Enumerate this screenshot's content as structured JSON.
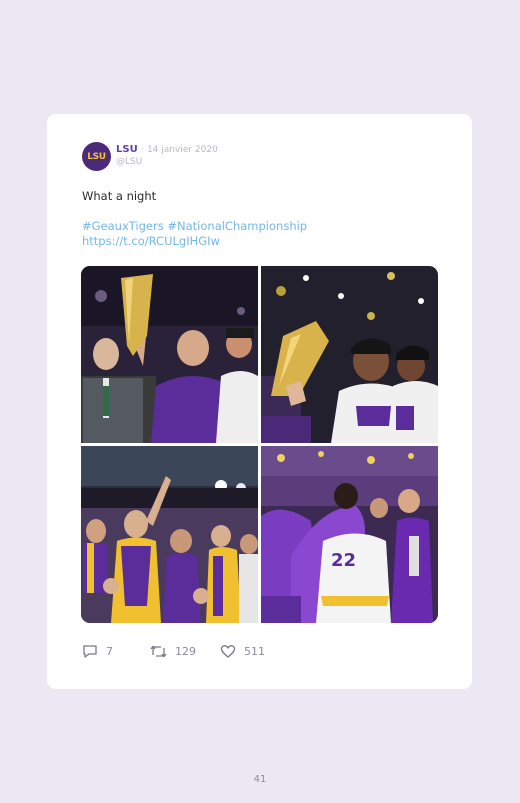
{
  "tweet": {
    "account_name": "LSU",
    "separator": "·",
    "date": "14 janvier 2020",
    "handle": "@LSU",
    "avatar_text": "LSU",
    "text": "What a night",
    "hashtags": "#GeauxTigers #NationalChampionship",
    "link": "https://t.co/RCULgIHGIw",
    "photos": [
      {
        "subject": "coach-lifting-trophy"
      },
      {
        "subject": "players-with-trophy"
      },
      {
        "subject": "fans-in-stands"
      },
      {
        "subject": "players-celebrating"
      }
    ],
    "replies": "7",
    "retweets": "129",
    "likes": "511"
  },
  "page": {
    "number": "41"
  },
  "colors": {
    "background": "#ebe8f3",
    "card": "#ffffff",
    "brand_purple": "#4b2a7b",
    "brand_gold": "#f6c52b",
    "link": "#73b8e6",
    "meta": "#b9b7c4"
  },
  "icons": [
    "reply-icon",
    "retweet-icon",
    "like-icon"
  ]
}
